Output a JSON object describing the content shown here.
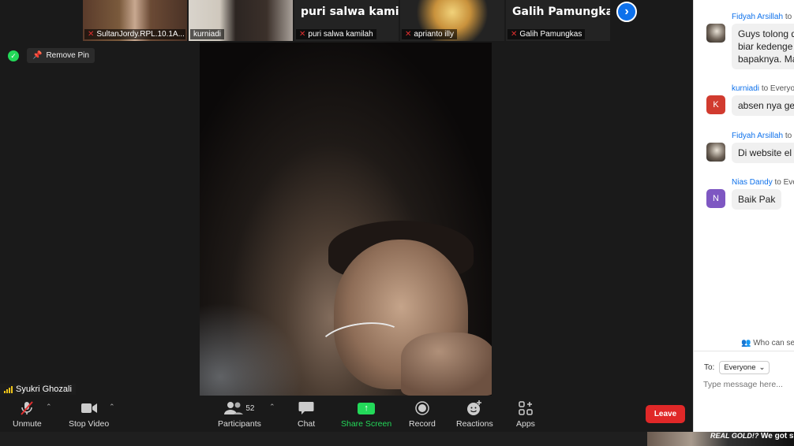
{
  "gallery": {
    "tiles": [
      {
        "label": "SultanJordy.RPL.10.1A...",
        "big_name": ""
      },
      {
        "label": "kurniadi",
        "big_name": ""
      },
      {
        "label": "puri salwa kamilah",
        "big_name": "puri salwa kami..."
      },
      {
        "label": "aprianto illy",
        "big_name": ""
      },
      {
        "label": "Galih Pamungkas",
        "big_name": "Galih Pamungkas"
      }
    ]
  },
  "pin": {
    "label": "Remove Pin"
  },
  "speaker": {
    "name": "Syukri Ghozali"
  },
  "toolbar": {
    "unmute": "Unmute",
    "stop_video": "Stop Video",
    "participants": "Participants",
    "participants_count": "52",
    "chat": "Chat",
    "share_screen": "Share Screen",
    "record": "Record",
    "reactions": "Reactions",
    "apps": "Apps",
    "leave": "Leave"
  },
  "chat": {
    "messages": [
      {
        "sender": "Fidyah Arsillah",
        "to": "to",
        "avatar": "",
        "text": "Guys tolong d"
      },
      {
        "sender": "kurniadi",
        "to": "to Everyo",
        "avatar": "K",
        "text": "absen nya ge"
      },
      {
        "sender": "Fidyah Arsillah",
        "to": "to",
        "avatar": "",
        "text": "Di website el"
      },
      {
        "sender": "Nias Dandy",
        "to": "to Eve",
        "avatar": "N",
        "text": "Baik Pak"
      }
    ],
    "msg1_line2": "biar kedenge",
    "msg1_line3": "bapaknya. Ma",
    "who_can_see": "Who can se",
    "to_label": "To:",
    "recipient": "Everyone",
    "placeholder": "Type message here..."
  },
  "taskbar_peek": {
    "text1": "REAL GOLD!?",
    "text2": "We got s"
  },
  "colors": {
    "accent": "#0e71eb",
    "share": "#23d959",
    "leave": "#e02828",
    "muted": "#e02f2f",
    "avatar_k": "#d13b2f",
    "avatar_n": "#7e57c2"
  }
}
